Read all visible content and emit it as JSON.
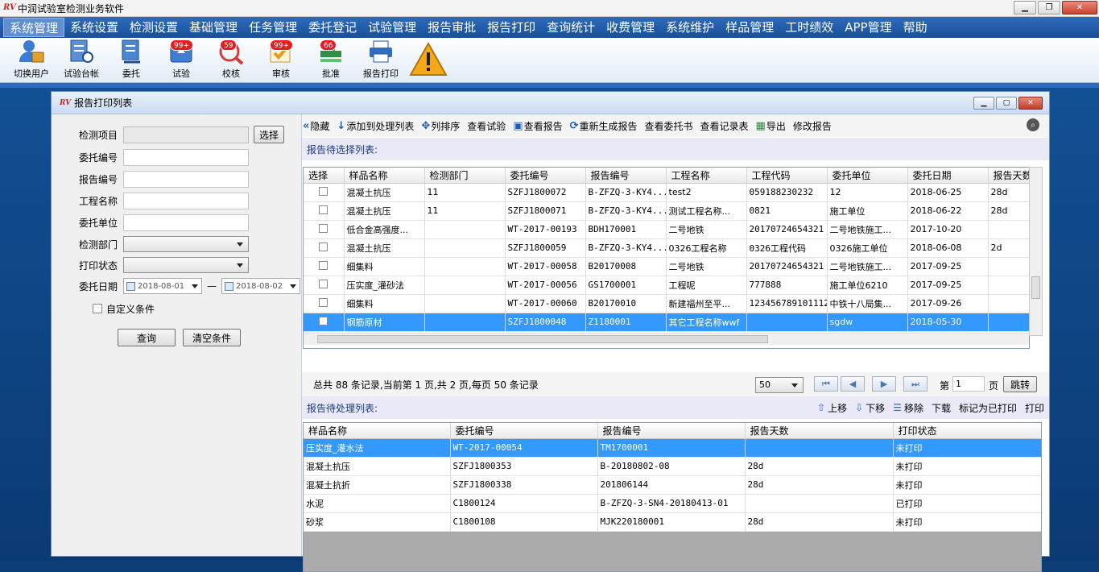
{
  "window": {
    "title": "中润试验室检测业务软件",
    "logo": "RV"
  },
  "menu": [
    "系统管理",
    "系统设置",
    "检测设置",
    "基础管理",
    "任务管理",
    "委托登记",
    "试验管理",
    "报告审批",
    "报告打印",
    "查询统计",
    "收费管理",
    "系统维护",
    "样品管理",
    "工时绩效",
    "APP管理",
    "帮助"
  ],
  "toolbar": [
    {
      "label": "切换用户",
      "icon": "user-switch-icon",
      "badge": ""
    },
    {
      "label": "试验台帐",
      "icon": "ledger-icon",
      "badge": ""
    },
    {
      "label": "委托",
      "icon": "entrust-icon",
      "badge": ""
    },
    {
      "label": "试验",
      "icon": "test-icon",
      "badge": "99+"
    },
    {
      "label": "校核",
      "icon": "check-icon",
      "badge": "59"
    },
    {
      "label": "审核",
      "icon": "review-icon",
      "badge": "99+"
    },
    {
      "label": "批准",
      "icon": "approve-icon",
      "badge": "66"
    },
    {
      "label": "报告打印",
      "icon": "printer-icon",
      "badge": ""
    },
    {
      "label": "",
      "icon": "warning-icon",
      "badge": ""
    }
  ],
  "subwin": {
    "title": "报告打印列表",
    "logo": "RV"
  },
  "filters": {
    "item_label": "检测项目",
    "select_btn": "选择",
    "entrust_no": "委托编号",
    "report_no": "报告编号",
    "project": "工程名称",
    "unit": "委托单位",
    "dept": "检测部门",
    "print_state": "打印状态",
    "date": "委托日期",
    "date_from": "2018-08-01",
    "date_to": "2018-08-02",
    "dash": "—",
    "custom": "自定义条件",
    "query": "查询",
    "clear": "清空条件"
  },
  "rtools": [
    "隐藏",
    "添加到处理列表",
    "列排序",
    "查看试验",
    "查看报告",
    "重新生成报告",
    "查看委托书",
    "查看记录表",
    "导出",
    "修改报告"
  ],
  "section1": "报告待选择列表:",
  "grid1_cols": [
    "选择",
    "样品名称",
    "检测部门",
    "委托编号",
    "报告编号",
    "工程名称",
    "工程代码",
    "委托单位",
    "委托日期",
    "报告天数"
  ],
  "grid1_rows": [
    [
      "",
      "混凝土抗压",
      "11",
      "SZFJ1800072",
      "B-ZFZQ-3-KY4...",
      "test2",
      "059188230232",
      "12",
      "2018-06-25",
      "28d"
    ],
    [
      "",
      "混凝土抗压",
      "11",
      "SZFJ1800071",
      "B-ZFZQ-3-KY4...",
      "测试工程名称...",
      "0821",
      "施工单位",
      "2018-06-22",
      "28d"
    ],
    [
      "",
      "低合金高强度...",
      "",
      "WT-2017-00193",
      "BDH170001",
      "二号地铁",
      "20170724654321",
      "二号地铁施工...",
      "2017-10-20",
      ""
    ],
    [
      "",
      "混凝土抗压",
      "",
      "SZFJ1800059",
      "B-ZFZQ-3-KY4...",
      "0326工程名称",
      "0326工程代码",
      "0326施工单位",
      "2018-06-08",
      "2d"
    ],
    [
      "",
      "细集料",
      "",
      "WT-2017-00058",
      "B20170008",
      "二号地铁",
      "20170724654321",
      "二号地铁施工...",
      "2017-09-25",
      ""
    ],
    [
      "",
      "压实度_灌砂法",
      "",
      "WT-2017-00056",
      "GS1700001",
      "工程呢",
      "777888",
      "施工单位6210",
      "2017-09-25",
      ""
    ],
    [
      "",
      "细集料",
      "",
      "WT-2017-00060",
      "B20170010",
      "新建福州至平...",
      "123456789101112",
      "中铁十八局集...",
      "2017-09-26",
      ""
    ],
    [
      "",
      "钢筋原材",
      "",
      "SZFJ1800048",
      "Z1180001",
      "其它工程名称wwf",
      "",
      "sgdw",
      "2018-05-30",
      ""
    ]
  ],
  "pager": {
    "summary": "总共 88 条记录,当前第 1 页,共 2 页,每页 50 条记录",
    "size": "50",
    "page_prefix": "第",
    "page": "1",
    "page_suffix": "页",
    "jump": "跳转"
  },
  "section2": "报告待处理列表:",
  "section2_tools": [
    "上移",
    "下移",
    "移除",
    "下载",
    "标记为已打印",
    "打印"
  ],
  "grid2_cols": [
    "样品名称",
    "委托编号",
    "报告编号",
    "报告天数",
    "打印状态"
  ],
  "grid2_rows": [
    [
      "压实度_灌水法",
      "WT-2017-00054",
      "TM1700001",
      "",
      "未打印"
    ],
    [
      "混凝土抗压",
      "SZFJ1800353",
      "B-20180802-08",
      "28d",
      "未打印"
    ],
    [
      "混凝土抗折",
      "SZFJ1800338",
      "201806144",
      "28d",
      "未打印"
    ],
    [
      "水泥",
      "C1800124",
      "B-ZFZQ-3-SN4-20180413-01",
      "",
      "已打印"
    ],
    [
      "砂浆",
      "C1800108",
      "MJK220180001",
      "28d",
      "未打印"
    ]
  ]
}
